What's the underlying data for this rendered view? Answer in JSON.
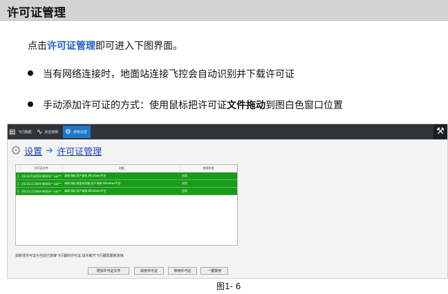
{
  "header": {
    "title": "许可证管理"
  },
  "intro": {
    "before": "点击",
    "highlight": "许可证管理",
    "after": "即可进入下图界面。"
  },
  "bullets": {
    "b1": {
      "text": "当有网络连接时，地面站连接飞控会自动识别并下载许可证"
    },
    "b2": {
      "before": "手动添加许可证的方式：使用鼠标把许可证",
      "bold": "文件拖动",
      "after": "到图白色窗口位置"
    }
  },
  "app": {
    "tabs": [
      {
        "label": "飞行数据",
        "icon": "document-icon"
      },
      {
        "label": "状态参数",
        "icon": "chart-icon"
      },
      {
        "label": "参数设置",
        "icon": "gear-icon"
      }
    ],
    "corner_icon": "tools-icon",
    "breadcrumb": {
      "root": "设置",
      "current": "许可证管理"
    },
    "table": {
      "columns": [
        "",
        "许可证文件",
        "功能",
        "使用状态"
      ],
      "rows": [
        {
          "index": "1",
          "file": "20230704050-00000-*.swt**",
          "feature": "调参功能,用户调参,Windows平台",
          "status": "启用"
        },
        {
          "index": "2",
          "file": "20231111009-00000-*.swt**",
          "feature": "调参功能,地面站功能,用户调参,Windows平台",
          "status": "启用"
        },
        {
          "index": "3",
          "file": "20231111008-00000-*.swt**",
          "feature": "调参功能,用户调参,Windows平台",
          "status": "启用"
        }
      ],
      "row_color": "#1a9b1a"
    },
    "note": "如新增许可证为当前已连接飞行器的许可证,请先断开飞行器再重新连接.",
    "buttons": {
      "add": "增加许可证文件",
      "enable": "启用许可证",
      "disable": "禁用许可证",
      "one_click_disable": "一键禁用"
    }
  },
  "caption": "图1- 6"
}
